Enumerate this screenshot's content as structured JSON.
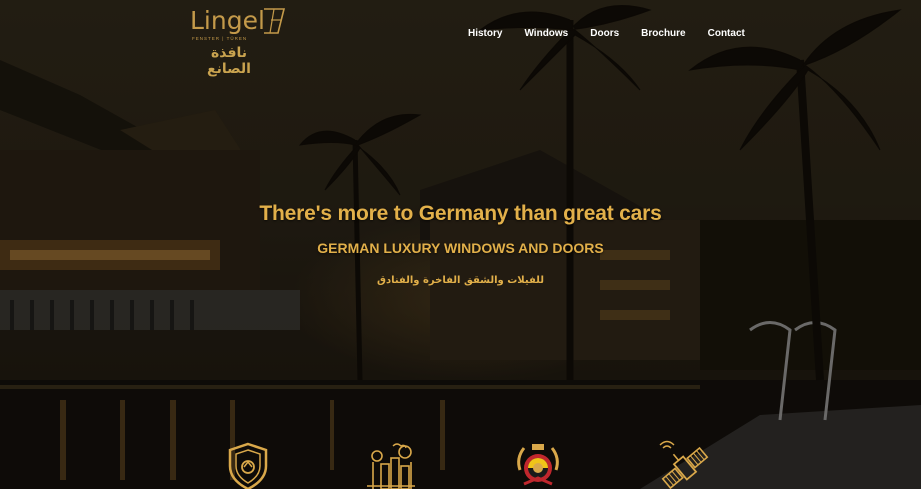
{
  "brand": {
    "logo_word": "Lingel",
    "logo_sub": "FENSTER | TÜREN",
    "logo_arabic": "نافذة الصانع",
    "gold": "#c49a4a"
  },
  "nav": {
    "items": [
      "History",
      "Windows",
      "Doors",
      "Brochure",
      "Contact"
    ]
  },
  "hero": {
    "headline": "There's more to Germany than great cars",
    "subline": "GERMAN LUXURY WINDOWS AND DOORS",
    "arabic_line": "للفيلات والشقق الفاخرة والفنادق",
    "accent": "#e2b04a"
  },
  "features": {
    "icons": [
      "shield-icon",
      "city-icon",
      "german-quality-emblem-icon",
      "satellite-icon"
    ]
  }
}
